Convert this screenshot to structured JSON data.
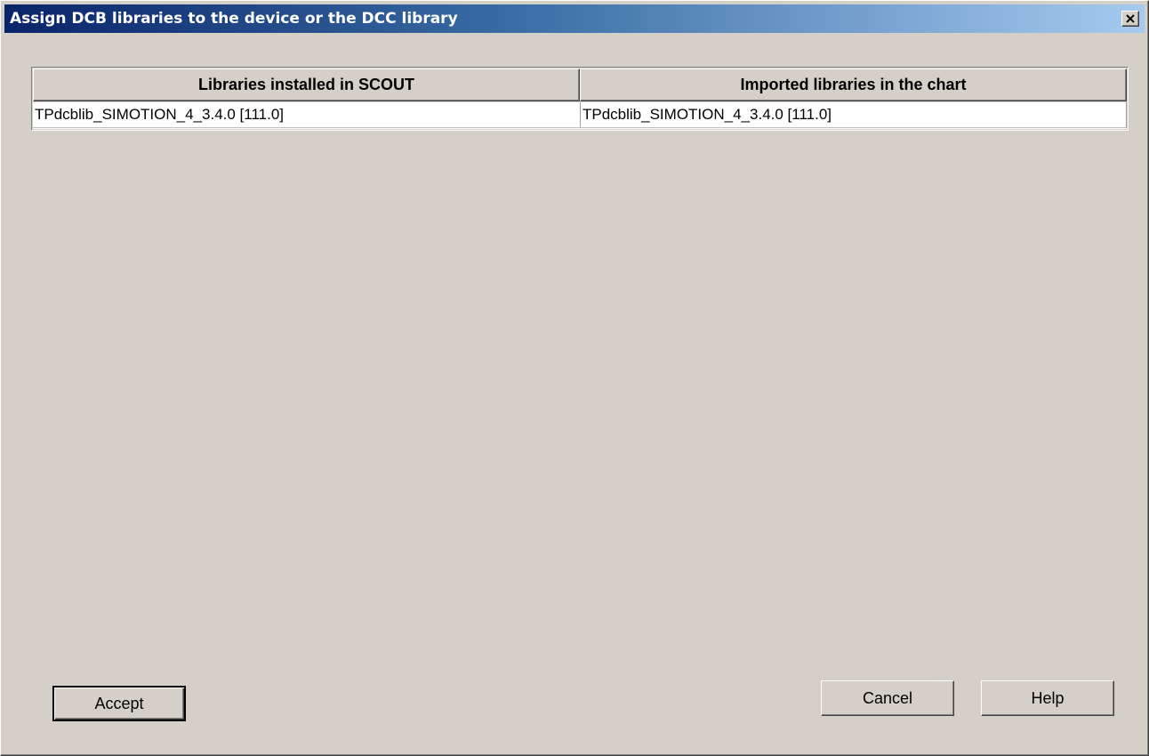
{
  "dialog": {
    "title": "Assign DCB libraries to the device or the DCC library",
    "close_icon": "close-icon"
  },
  "table": {
    "columns": [
      "Libraries installed in SCOUT",
      "Imported libraries in the chart"
    ],
    "rows": [
      [
        "TPdcblib_SIMOTION_4_3.4.0 [111.0]",
        "TPdcblib_SIMOTION_4_3.4.0 [111.0]"
      ]
    ]
  },
  "buttons": {
    "accept": "Accept",
    "cancel": "Cancel",
    "help": "Help"
  }
}
